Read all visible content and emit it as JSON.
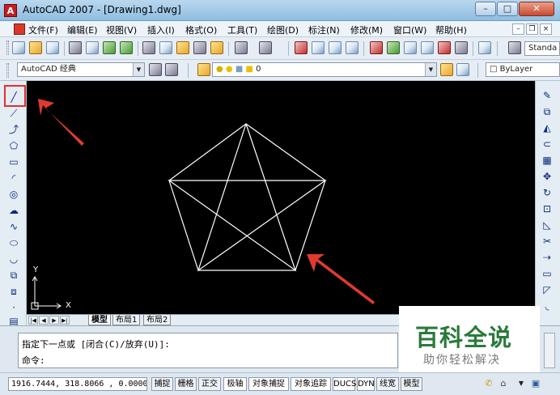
{
  "window": {
    "title": "AutoCAD 2007 - [Drawing1.dwg]",
    "icon_letter": "A",
    "minimize": "–",
    "restore": "□",
    "close": "✕"
  },
  "menu": {
    "items": [
      "文件(F)",
      "编辑(E)",
      "视图(V)",
      "插入(I)",
      "格式(O)",
      "工具(T)",
      "绘图(D)",
      "标注(N)",
      "修改(M)",
      "窗口(W)",
      "帮助(H)"
    ],
    "mdi_minimize": "–",
    "mdi_restore": "❐",
    "mdi_close": "×"
  },
  "toolbar": {
    "text_style": "Standa",
    "workspace": "AutoCAD 经典",
    "layer": "0",
    "linetype": "ByLayer"
  },
  "layout_tabs": [
    "模型",
    "布局1",
    "布局2"
  ],
  "ucs": {
    "x_label": "X",
    "y_label": "Y"
  },
  "command": {
    "line1": "指定下一点或 [闭合(C)/放弃(U)]:",
    "line2": "命令:"
  },
  "status": {
    "coordinates": "1916.7444, 318.8066 , 0.0000",
    "toggles": [
      "捕捉",
      "栅格",
      "正交",
      "极轴",
      "对象捕捉",
      "对象追踪",
      "DUCS",
      "DYN",
      "线宽",
      "模型"
    ]
  },
  "watermark": {
    "title": "百科全说",
    "subtitle": "助你轻松解决"
  },
  "colors": {
    "canvas": "#000000",
    "lines": "#ffffff",
    "arrow": "#e03a30",
    "watermark": "#2a7a3a"
  }
}
